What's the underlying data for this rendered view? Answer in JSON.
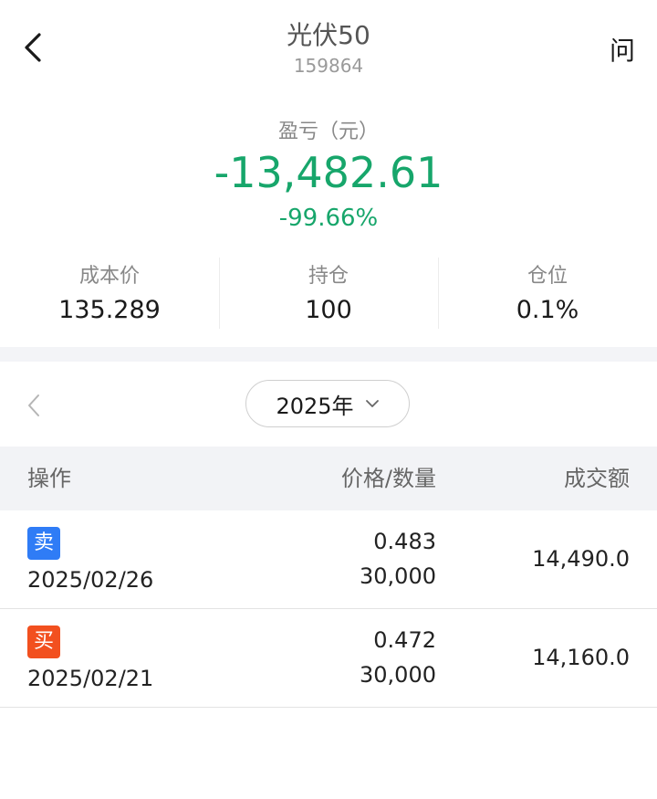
{
  "header": {
    "title": "光伏50",
    "code": "159864",
    "help_label": "问"
  },
  "summary": {
    "pnl_label": "盈亏（元）",
    "pnl_value": "-13,482.61",
    "pnl_percent": "-99.66%",
    "loss_color": "#17a66b"
  },
  "stats": [
    {
      "label": "成本价",
      "value": "135.289"
    },
    {
      "label": "持仓",
      "value": "100"
    },
    {
      "label": "仓位",
      "value": "0.1%"
    }
  ],
  "year_selector": {
    "selected": "2025年"
  },
  "table": {
    "headers": {
      "operation": "操作",
      "price_qty": "价格/数量",
      "amount": "成交额"
    },
    "rows": [
      {
        "type": "卖",
        "kind": "sell",
        "color": "#2f7cf6",
        "date": "2025/02/26",
        "price": "0.483",
        "qty": "30,000",
        "amount": "14,490.0"
      },
      {
        "type": "买",
        "kind": "buy",
        "color": "#f2501f",
        "date": "2025/02/21",
        "price": "0.472",
        "qty": "30,000",
        "amount": "14,160.0"
      }
    ]
  },
  "icons": {
    "back": "chevron-left-icon",
    "prev_year": "chevron-left-icon",
    "dropdown": "chevron-down-icon"
  }
}
